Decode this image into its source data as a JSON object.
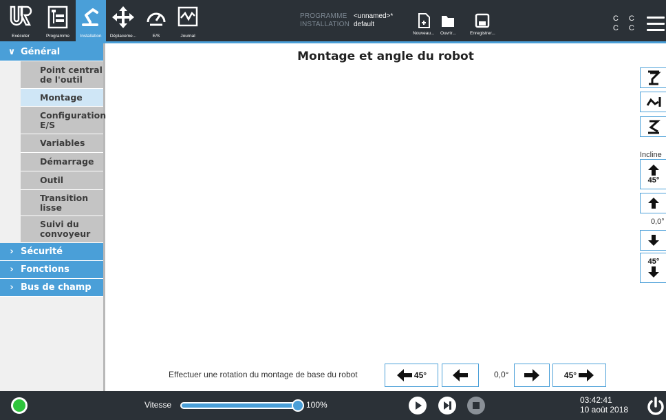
{
  "header": {
    "nav": [
      {
        "id": "executer",
        "label": "Exécuter",
        "icon": "ur-logo-icon"
      },
      {
        "id": "programme",
        "label": "Programme",
        "icon": "program-tree-icon"
      },
      {
        "id": "installation",
        "label": "Installation",
        "icon": "robot-arm-icon",
        "active": true
      },
      {
        "id": "deplacement",
        "label": "Déplaceme...",
        "icon": "move-arrows-icon"
      },
      {
        "id": "es",
        "label": "E/S",
        "icon": "io-gauge-icon"
      },
      {
        "id": "journal",
        "label": "Journal",
        "icon": "log-graph-icon"
      }
    ],
    "programme_key": "PROGRAMME",
    "programme_value": "<unnamed>*",
    "installation_key": "INSTALLATION",
    "installation_value": "default",
    "file_buttons": [
      {
        "label": "Nouveau...",
        "icon": "new-file-icon"
      },
      {
        "label": "Ouvrir...",
        "icon": "open-folder-icon"
      },
      {
        "label": "Enregistrer...",
        "icon": "save-icon"
      }
    ],
    "cc_top": "C C",
    "cc_bottom": "C C",
    "accent": "#4a9fd8",
    "bg": "#2b3137"
  },
  "sidebar": {
    "sections": [
      {
        "label": "Général",
        "expanded": true,
        "items": [
          {
            "label": "Point central de l'outil"
          },
          {
            "label": "Montage",
            "active": true
          },
          {
            "label": "Configuration E/S"
          },
          {
            "label": "Variables"
          },
          {
            "label": "Démarrage"
          },
          {
            "label": "Outil"
          },
          {
            "label": "Transition lisse"
          },
          {
            "label": "Suivi du convoyeur"
          }
        ]
      },
      {
        "label": "Sécurité",
        "expanded": false
      },
      {
        "label": "Fonctions",
        "expanded": false
      },
      {
        "label": "Bus de champ",
        "expanded": false
      }
    ]
  },
  "main": {
    "title": "Montage et angle du robot",
    "mount_buttons": [
      {
        "icon": "mount-floor-icon"
      },
      {
        "icon": "mount-wall-icon"
      },
      {
        "icon": "mount-ceiling-icon"
      }
    ],
    "incline_label": "Incline",
    "tilt": {
      "up_45": "45°",
      "value": "0,0°",
      "down_45": "45°"
    },
    "rotation": {
      "label": "Effectuer une rotation du montage de base du robot",
      "left_45": "45°",
      "value": "0,0°",
      "right_45": "45°"
    }
  },
  "footer": {
    "speed_label": "Vitesse",
    "speed_percent": "100%",
    "speed_fraction": 1.0,
    "time": "03:42:41",
    "date": "10 août 2018",
    "status_color": "#2ec43c"
  }
}
